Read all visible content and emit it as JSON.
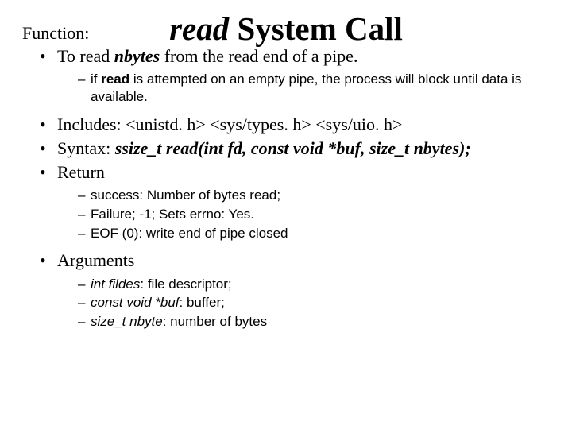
{
  "title": {
    "read": "read",
    "rest": " System Call"
  },
  "functionLabel": "Function:",
  "bullets": {
    "toRead": {
      "pre": "To read ",
      "nbytes": "nbytes",
      "post": "  from the read end of a pipe."
    },
    "toReadSub": {
      "if": "if ",
      "read": "read",
      "rest": " is attempted on an empty pipe, the process will block until data is available."
    },
    "includes": "Includes:     <unistd. h>  <sys/types. h>  <sys/uio. h>",
    "syntax": {
      "label": "Syntax:   ",
      "sig": "ssize_t read(int fd, const void *buf, size_t  nbytes);"
    },
    "ret": "Return",
    "retSub": {
      "a": "success: Number of bytes read;",
      "b": "Failure; -1; Sets errno: Yes.",
      "c": "EOF (0): write end of pipe closed"
    },
    "args": "Arguments",
    "argsSub": {
      "a_i": "int fildes",
      "a_r": ": file descriptor;",
      "b_i": "const void *buf",
      "b_r": ": buffer;",
      "c_i": "size_t nbyte",
      "c_r": ": number of bytes"
    }
  }
}
